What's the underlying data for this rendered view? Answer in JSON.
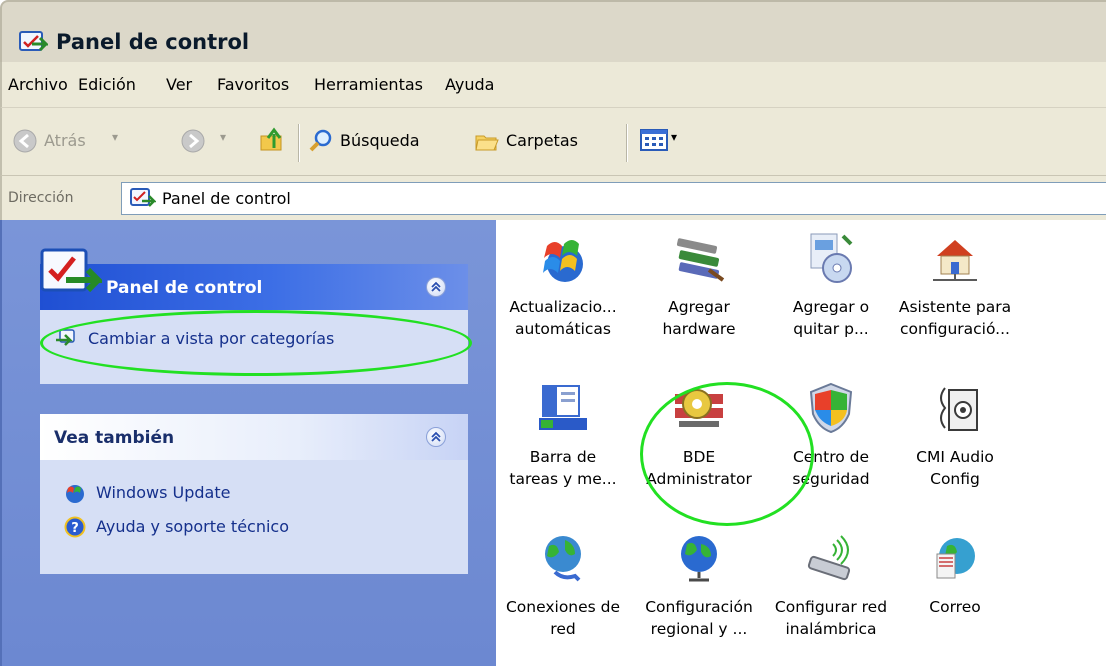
{
  "window": {
    "title": "Panel de control"
  },
  "menu": {
    "items": [
      "Archivo",
      "Edición",
      "Ver",
      "Favoritos",
      "Herramientas",
      "Ayuda"
    ]
  },
  "toolbar": {
    "back_label": "Atrás",
    "search_label": "Búsqueda",
    "folders_label": "Carpetas"
  },
  "address": {
    "label": "Dirección",
    "value": "Panel de control"
  },
  "sidebar": {
    "panel1": {
      "title": "Panel de control",
      "link": "Cambiar a vista por categorías"
    },
    "panel2": {
      "title": "Vea también",
      "links": [
        "Windows Update",
        "Ayuda y soporte técnico"
      ]
    }
  },
  "items": [
    {
      "line1": "Actualizacio...",
      "line2": "automáticas",
      "icon": "windows-update-icon"
    },
    {
      "line1": "Agregar",
      "line2": "hardware",
      "icon": "add-hardware-icon"
    },
    {
      "line1": "Agregar o",
      "line2": "quitar p...",
      "icon": "add-remove-programs-icon"
    },
    {
      "line1": "Asistente para",
      "line2": "configuració...",
      "icon": "network-setup-wizard-icon"
    },
    {
      "line1": "Barra de",
      "line2": "tareas y me...",
      "icon": "taskbar-icon"
    },
    {
      "line1": "BDE",
      "line2": "Administrator",
      "icon": "bde-administrator-icon"
    },
    {
      "line1": "Centro de",
      "line2": "seguridad",
      "icon": "security-center-icon"
    },
    {
      "line1": "CMI Audio",
      "line2": "Config",
      "icon": "cmi-audio-icon"
    },
    {
      "line1": "Conexiones de",
      "line2": "red",
      "icon": "network-connections-icon"
    },
    {
      "line1": "Configuración",
      "line2": "regional y ...",
      "icon": "regional-settings-icon"
    },
    {
      "line1": "Configurar red",
      "line2": "inalámbrica",
      "icon": "wireless-network-icon"
    },
    {
      "line1": "Correo",
      "line2": "",
      "icon": "mail-icon"
    }
  ],
  "colors": {
    "highlight_oval": "#22e022",
    "sidebar_bg": "#7a95d8",
    "panel_bg": "#d6dff5"
  }
}
